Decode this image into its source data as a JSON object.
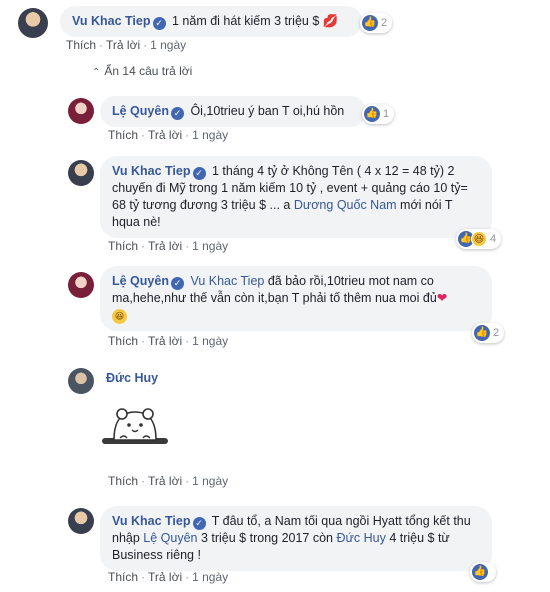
{
  "comments": [
    {
      "author": "Vu Khac Tiep",
      "text": "1 năm đi hát kiếm 3 triệu $",
      "emoji": "💋",
      "reactions": {
        "count": "2"
      },
      "actions": {
        "like": "Thích",
        "reply": "Trả lời",
        "time": "1 ngày"
      }
    },
    {
      "author": "Lệ Quyên",
      "text": "Ôi,10trieu ý ban T oi,hú hồn",
      "reactions": {
        "count": "1"
      },
      "actions": {
        "like": "Thích",
        "reply": "Trả lời",
        "time": "1 ngày"
      }
    },
    {
      "author": "Vu Khac Tiep",
      "text_before": "1 tháng 4 tỷ ở Không Tên ( 4 x 12 = 48 tỷ) 2 chuyến đi Mỹ trong 1 năm kiếm 10 tỷ , event + quảng cáo 10 tỷ= 68 tỷ tương đương 3 triệu $ ... a ",
      "mention": "Dương Quốc Nam",
      "text_after": " mới nói T hqua nè!",
      "reactions": {
        "count": "4"
      },
      "actions": {
        "like": "Thích",
        "reply": "Trả lời",
        "time": "1 ngày"
      }
    },
    {
      "author": "Lệ Quyên",
      "mention": "Vu Khac Tiep",
      "text": " đã bảo rồi,10trieu mot nam co ma,hehe,như thế vẫn còn it,bạn T phải tố thêm nua moi đủ",
      "reactions": {
        "count": "2"
      },
      "actions": {
        "like": "Thích",
        "reply": "Trả lời",
        "time": "1 ngày"
      }
    },
    {
      "author": "Đức Huy",
      "actions": {
        "like": "Thích",
        "reply": "Trả lời",
        "time": "1 ngày"
      }
    },
    {
      "author": "Vu Khac Tiep",
      "text_before": "T đâu tổ, a Nam tối qua ngồi Hyatt tổng kết thu nhập ",
      "mention1": "Lệ Quyên",
      "text_middle": " 3 triệu $ trong 2017 còn ",
      "mention2": "Đức Huy",
      "text_after": " 4 triệu $ từ Business riêng !",
      "reactions": {
        "count": ""
      },
      "actions": {
        "like": "Thích",
        "reply": "Trả lời",
        "time": "1 ngày"
      }
    }
  ],
  "hide_replies": "Ẩn 14 câu trả lời",
  "colors": {
    "link": "#365899",
    "bubble": "#f2f3f5",
    "like_blue": "#4267b2"
  }
}
